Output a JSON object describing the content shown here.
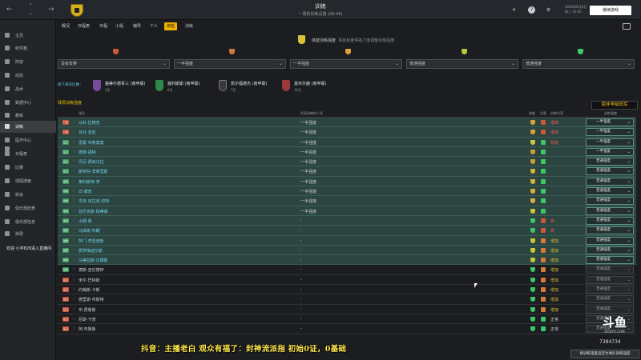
{
  "topbar": {
    "title": "训练",
    "subtitle": "一周的训练设置 (06:49)",
    "date_line1": "2026年6月6日",
    "date_line2": "周三 10:00",
    "continue_label": "继续游戏",
    "help_label": "?",
    "badge_color": "#d8b01f"
  },
  "sidebar": {
    "items": [
      {
        "label": "主页",
        "icon": "home-icon"
      },
      {
        "label": "收件箱",
        "icon": "inbox-icon"
      },
      {
        "label": "阵容",
        "icon": "squad-icon"
      },
      {
        "label": "动态",
        "icon": "dynamics-icon"
      },
      {
        "label": "战术",
        "icon": "tactics-icon"
      },
      {
        "label": "数据中心",
        "icon": "data-hub-icon"
      },
      {
        "label": "教练",
        "icon": "staff-icon"
      },
      {
        "label": "训练",
        "icon": "training-icon"
      },
      {
        "label": "医疗中心",
        "icon": "medical-icon"
      },
      {
        "label": "",
        "icon": "scouting-icon"
      },
      {
        "label": "日程表",
        "icon": "schedule-icon"
      },
      {
        "label": "比赛",
        "icon": "competitions-icon"
      },
      {
        "label": "球探搜索",
        "icon": "scout-icon"
      },
      {
        "label": "转会",
        "icon": "transfers-icon"
      },
      {
        "label": "俱乐部愿景",
        "icon": "vision-icon"
      },
      {
        "label": "俱乐部信息",
        "icon": "club-info-icon"
      },
      {
        "label": "财政",
        "icon": "finance-icon"
      }
    ],
    "overlay_text": "欢迎 小宇826进入直播间"
  },
  "tabs": [
    "概况",
    "日程表",
    "日程",
    "小组",
    "辅导",
    "个人",
    "体能",
    "训练"
  ],
  "active_tab": 6,
  "intensity": {
    "title": "体能训练强度",
    "hint": "将鼠标悬停各力值调整训练强度",
    "levels": [
      "#c85a3c",
      "#d27a3a",
      "#e0a23a",
      "#b8c83a",
      "#3cc86a"
    ],
    "selects": [
      "没有安排",
      "一半强度",
      "一半强度",
      "普通强度",
      "普通强度"
    ]
  },
  "matches": {
    "label": "接下来的比赛：",
    "items": [
      {
        "name": "塞蒂尔德青三 (南甲联)",
        "days": "3天",
        "crest": "#7a4a9a"
      },
      {
        "name": "塞利斯斯 (南甲联)",
        "days": "6天",
        "crest": "#2e8a4a"
      },
      {
        "name": "凯尔福德杰 (南甲联)",
        "days": "7天",
        "crest": "#3a3a3a"
      },
      {
        "name": "基布尔鹿 (南甲联)",
        "days": "10天",
        "crest": "#9a3a3a"
      }
    ]
  },
  "table": {
    "title": "球员训练强度",
    "headers": {
      "player": "球员",
      "coach": "负责训练的人员",
      "condition": "体能",
      "load": "比赛",
      "rating": "训练负荷",
      "intensity": "训练强度"
    },
    "rows": [
      {
        "pos": "门将",
        "gk": true,
        "name": "马科·拉德克",
        "coach": "一半强度",
        "cond": "#d8a23a",
        "load": "#c85a3c",
        "tag": "很高",
        "tag_color": "#e85c5c",
        "intensity": "一半强度",
        "selected": true
      },
      {
        "pos": "门将",
        "gk": true,
        "name": "瓦托·亚伯",
        "coach": "一半强度",
        "cond": "#d8a23a",
        "load": "#c85a3c",
        "tag": "很高",
        "tag_color": "#e85c5c",
        "intensity": "一半强度",
        "selected": true
      },
      {
        "pos": "后卫",
        "gk": false,
        "name": "雷蒙·布鲁莫莫",
        "coach": "一半强度",
        "cond": "#c8c83a",
        "load": "#3cc86a",
        "tag": "较高",
        "tag_color": "#e85c5c",
        "intensity": "一半强度",
        "selected": true
      },
      {
        "pos": "后卫",
        "gk": false,
        "name": "德姆·福特",
        "coach": "一半强度",
        "cond": "#c8a03a",
        "load": "#3cc86a",
        "tag": "",
        "tag_color": "#e85c5c",
        "intensity": "一半强度",
        "selected": true
      },
      {
        "pos": "后卫",
        "gk": false,
        "name": "丹尼·费纳马拉",
        "coach": "一半强度",
        "cond": "#c8a03a",
        "load": "#3cc86a",
        "tag": "",
        "tag_color": "#e85c5c",
        "intensity": "普通强度",
        "selected": true
      },
      {
        "pos": "后卫",
        "gk": false,
        "name": "斯特芬·李弗里斯",
        "coach": "一半强度",
        "cond": "#d8b03a",
        "load": "#3cc86a",
        "tag": "",
        "tag_color": "#e85c5c",
        "intensity": "普通强度",
        "selected": true
      },
      {
        "pos": "中场",
        "gk": false,
        "name": "莱利斯特·李",
        "coach": "一半强度",
        "cond": "#d8b03a",
        "load": "#3cc86a",
        "tag": "",
        "tag_color": "#e85c5c",
        "intensity": "普通强度",
        "selected": true
      },
      {
        "pos": "中场",
        "gk": false,
        "name": "日·姆普",
        "coach": "一半强度",
        "cond": "#d8b03a",
        "load": "#3cc86a",
        "tag": "",
        "tag_color": "#e85c5c",
        "intensity": "普通强度",
        "selected": true
      },
      {
        "pos": "中场",
        "gk": false,
        "name": "杰克·克拉克·切特",
        "coach": "一半强度",
        "cond": "#d8b03a",
        "load": "#3cc86a",
        "tag": "",
        "tag_color": "#e85c5c",
        "intensity": "普通强度",
        "selected": true
      },
      {
        "pos": "中场",
        "gk": false,
        "name": "亚历克斯·帕蒂森",
        "coach": "一半强度",
        "cond": "#c8c83a",
        "load": "#3cc86a",
        "tag": "",
        "tag_color": "#e85c5c",
        "intensity": "普通强度",
        "selected": true
      },
      {
        "pos": "中场",
        "gk": false,
        "name": "山姆·佩",
        "coach": "-",
        "cond": "#3cc86a",
        "load": "#c85a3c",
        "tag": "高",
        "tag_color": "#e85c5c",
        "intensity": "普通强度",
        "selected": true
      },
      {
        "pos": "前锋",
        "gk": false,
        "name": "马库斯·布朗",
        "coach": "-",
        "cond": "#3cc86a",
        "load": "#c85a3c",
        "tag": "高",
        "tag_color": "#e85c5c",
        "intensity": "普通强度",
        "selected": true
      },
      {
        "pos": "前锋",
        "gk": false,
        "name": "萨门·李恩普斯",
        "coach": "-",
        "cond": "#c8c83a",
        "load": "#d87a3a",
        "tag": "增加",
        "tag_color": "#e0c040",
        "intensity": "普通强度",
        "selected": true
      },
      {
        "pos": "前锋",
        "gk": false,
        "name": "费罗梅迪尔斯",
        "coach": "-",
        "cond": "#c8c83a",
        "load": "#d87a3a",
        "tag": "增加",
        "tag_color": "#e0c040",
        "intensity": "普通强度",
        "selected": true
      },
      {
        "pos": "前锋",
        "gk": false,
        "name": "马蒂亚斯·达姆斯",
        "coach": "-",
        "cond": "#c8c83a",
        "load": "#d87a3a",
        "tag": "增加",
        "tag_color": "#e0c040",
        "intensity": "普通强度",
        "selected": true
      },
      {
        "pos": "前锋",
        "gk": false,
        "name": "德斯·亚伦德伊",
        "coach": "-",
        "cond": "#3cc86a",
        "load": "#d87a3a",
        "tag": "增加",
        "tag_color": "#e0c040",
        "intensity": "普通强度",
        "selected": false
      },
      {
        "pos": "后卫",
        "gk": true,
        "name": "米尔·巴特斯",
        "coach": "-",
        "cond": "#3cc86a",
        "load": "#d87a3a",
        "tag": "增加",
        "tag_color": "#e0c040",
        "intensity": "普通强度",
        "selected": false
      },
      {
        "pos": "后卫",
        "gk": true,
        "name": "约翰斯·卡斯",
        "coach": "-",
        "cond": "#3cc86a",
        "load": "#d87a3a",
        "tag": "增加",
        "tag_color": "#e0c040",
        "intensity": "普通强度",
        "selected": false
      },
      {
        "pos": "后卫",
        "gk": true,
        "name": "德里斯·布斯特",
        "coach": "-",
        "cond": "#3cc86a",
        "load": "#d87a3a",
        "tag": "增加",
        "tag_color": "#e0c040",
        "intensity": "普通强度",
        "selected": false
      },
      {
        "pos": "后卫",
        "gk": true,
        "name": "布·费鲁斯",
        "coach": "-",
        "cond": "#3cc86a",
        "load": "#d87a3a",
        "tag": "增加",
        "tag_color": "#e0c040",
        "intensity": "普通强度",
        "selected": false
      },
      {
        "pos": "后卫",
        "gk": true,
        "name": "尼斯·卡普",
        "coach": "-",
        "cond": "#3cc86a",
        "load": "#3cc86a",
        "tag": "正常",
        "tag_color": "#c9cdd2",
        "intensity": "普通强度",
        "selected": false
      },
      {
        "pos": "后卫",
        "gk": true,
        "name": "阿·布鲁斯",
        "coach": "-",
        "cond": "#3cc86a",
        "load": "#3cc86a",
        "tag": "正常",
        "tag_color": "#c9cdd2",
        "intensity": "普通强度",
        "selected": false
      }
    ]
  },
  "overlays": {
    "corner_caption": "南非甲级冠军",
    "bottom_caption": "抖音：主播老白 观众有福了：封神流派指 初始0证，0基础",
    "watermark": "斗鱼",
    "watermark_site": "DOUYU.COM",
    "room_id": "7384734",
    "bottom_action": "将训练强度设定为球队训练强度"
  }
}
